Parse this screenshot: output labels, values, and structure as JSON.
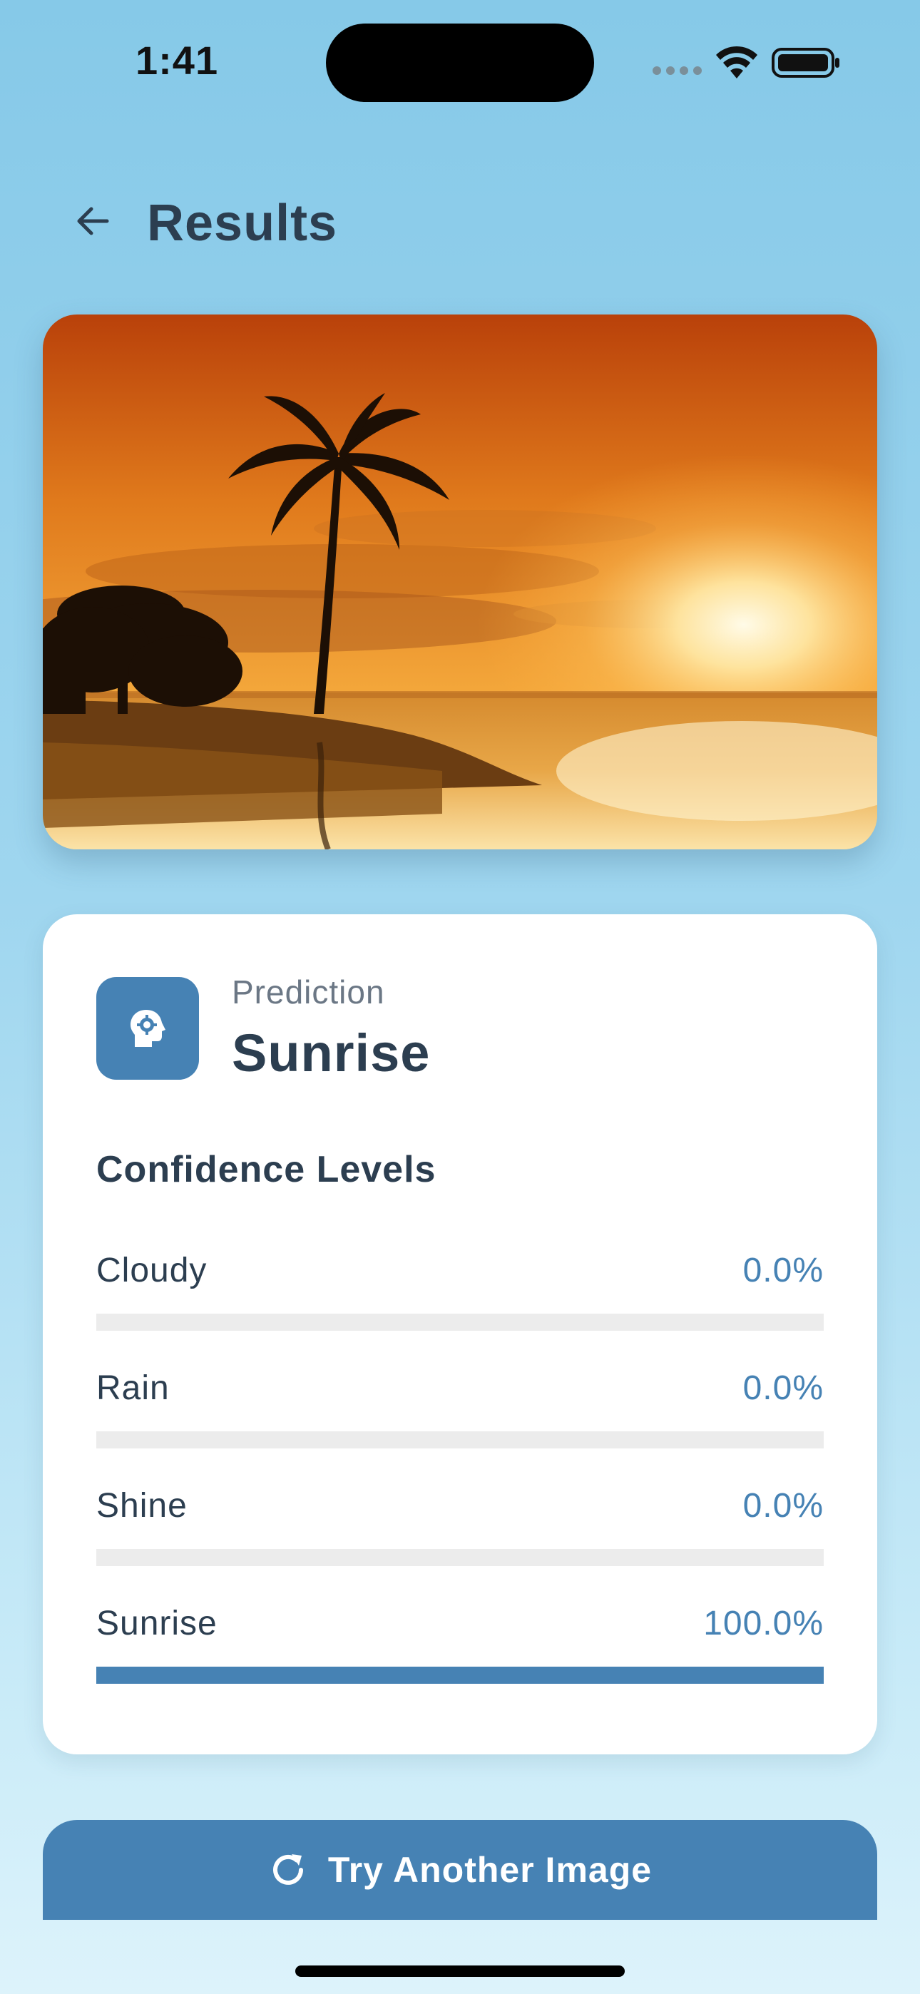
{
  "status_bar": {
    "time": "1:41"
  },
  "header": {
    "back_icon": "arrow-left-icon",
    "title": "Results"
  },
  "photo": {
    "subject": "sunrise-beach-photo"
  },
  "prediction": {
    "icon": "head-gear-icon",
    "label": "Prediction",
    "value": "Sunrise"
  },
  "confidence": {
    "heading": "Confidence Levels",
    "items": [
      {
        "name": "Cloudy",
        "value_text": "0.0%",
        "fraction": 0.0
      },
      {
        "name": "Rain",
        "value_text": "0.0%",
        "fraction": 0.0
      },
      {
        "name": "Shine",
        "value_text": "0.0%",
        "fraction": 0.0
      },
      {
        "name": "Sunrise",
        "value_text": "100.0%",
        "fraction": 1.0
      }
    ]
  },
  "action": {
    "icon": "refresh-icon",
    "label": "Try Another Image"
  },
  "colors": {
    "accent": "#4682b4",
    "text": "#2c3e50",
    "track": "#ececec"
  }
}
